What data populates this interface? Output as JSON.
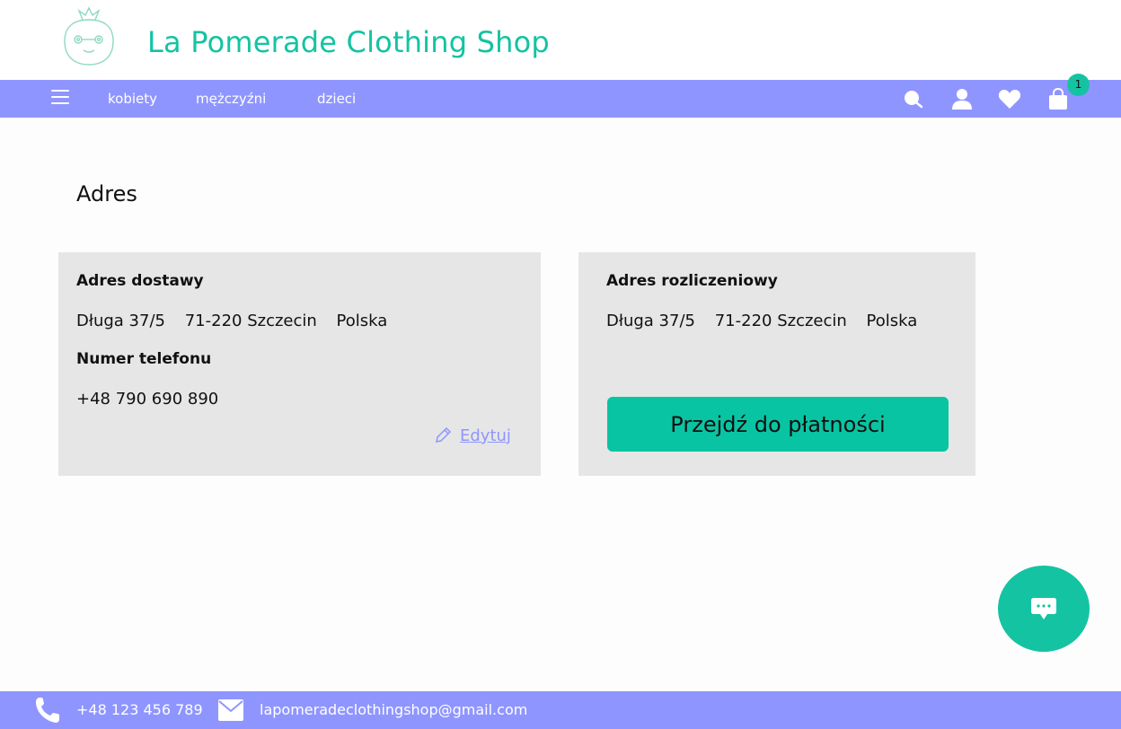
{
  "brand": {
    "title": "La Pomerade Clothing Shop",
    "logo_icon": "pomegranate-logo-icon"
  },
  "nav": {
    "menu_icon": "hamburger-menu-icon",
    "links": [
      "kobiety",
      "mężczyźni",
      "dzieci"
    ],
    "icons": [
      "search-icon",
      "user-icon",
      "heart-icon",
      "shopping-bag-icon"
    ],
    "cart_count": "1"
  },
  "page": {
    "title": "Adres"
  },
  "shipping": {
    "heading": "Adres dostawy",
    "address": [
      "Długa 37/5",
      "71-220 Szczecin",
      "Polska"
    ],
    "phone_heading": "Numer telefonu",
    "phone": "+48 790 690 890",
    "edit_label": "Edytuj"
  },
  "billing": {
    "heading": "Adres rozliczeniowy",
    "address": [
      "Długa 37/5",
      "71-220 Szczecin",
      "Polska"
    ],
    "pay_label": "Przejdź do płatności"
  },
  "chat": {
    "icon": "chat-bubble-icon"
  },
  "footer": {
    "phone": "+48 123 456 789",
    "email": "lapomeradeclothingshop@gmail.com"
  },
  "colors": {
    "accent": "#14c3a2",
    "nav": "#8f95ff",
    "card_bg": "#e6e6e6"
  }
}
